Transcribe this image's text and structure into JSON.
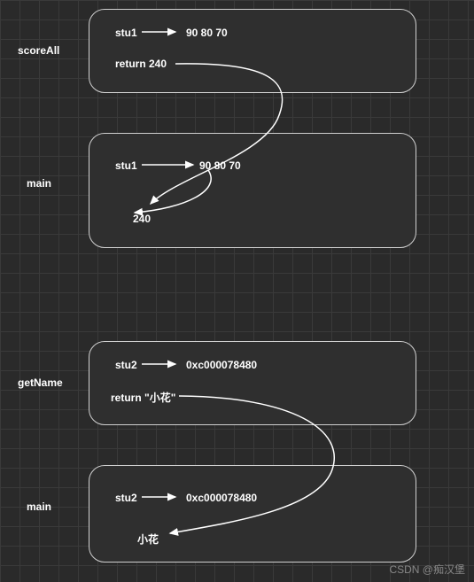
{
  "labels": {
    "scoreAll": "scoreAll",
    "main1": "main",
    "getName": "getName",
    "main2": "main"
  },
  "box1": {
    "stu": "stu1",
    "values": "90  80  70",
    "ret": "return 240"
  },
  "box2": {
    "stu": "stu1",
    "values": "90  80  70",
    "result": "240"
  },
  "box3": {
    "stu": "stu2",
    "addr": "0xc000078480",
    "ret": "return \"小花\""
  },
  "box4": {
    "stu": "stu2",
    "addr": "0xc000078480",
    "result": "小花"
  },
  "watermark": "CSDN @痴汉堡",
  "colors": {
    "bg": "#2a2a2a",
    "grid": "#3a3a3a",
    "boxBg": "#2f2f2f",
    "border": "#d0d0d0",
    "text": "#ffffff"
  }
}
